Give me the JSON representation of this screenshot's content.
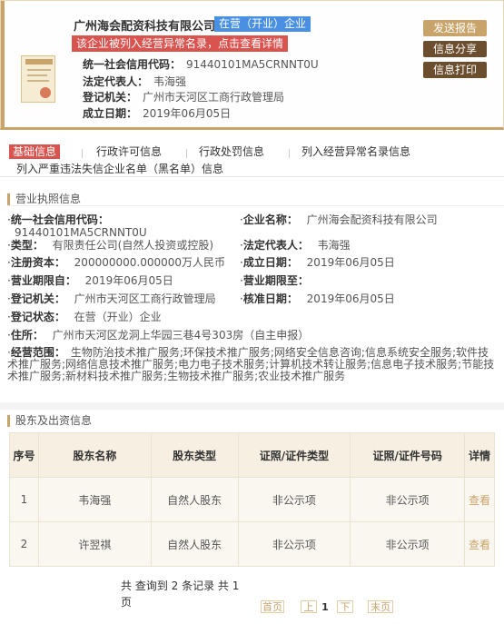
{
  "company": {
    "name": "广州海会配资科技有限公司",
    "status": "在营（开业）企业",
    "abnormal_notice": "该企业被列入经营异常名录，点击查看详情",
    "credit_code_label": "统一社会信用代码：",
    "credit_code": "91440101MA5CRNNT0U",
    "legal_rep_label": "法定代表人：",
    "legal_rep": "韦海强",
    "registry_label": "登记机关：",
    "registry": "广州市天河区工商行政管理局",
    "founded_label": "成立日期：",
    "founded": "2019年06月05日"
  },
  "actions": {
    "report": "发送报告",
    "share": "信息分享",
    "print": "信息打印"
  },
  "tabs": [
    "基础信息",
    "行政许可信息",
    "行政处罚信息",
    "列入经营异常名录信息",
    "列入严重违法失信企业名单（黑名单）信息"
  ],
  "license": {
    "section_title": "营业执照信息",
    "credit_code_label": "统一社会信用代码：",
    "credit_code": "91440101MA5CRNNT0U",
    "name_label": "企业名称：",
    "name": "广州海会配资科技有限公司",
    "type_label": "类型：",
    "type": "有限责任公司(自然人投资或控股)",
    "legal_rep_label": "法定代表人：",
    "legal_rep": "韦海强",
    "capital_label": "注册资本：",
    "capital": "200000000.000000万人民币",
    "founded_label": "成立日期：",
    "founded": "2019年06月05日",
    "term_start_label": "营业期限自：",
    "term_start": "2019年06月05日",
    "term_end_label": "营业期限至：",
    "term_end": "",
    "registry_label": "登记机关：",
    "registry": "广州市天河区工商行政管理局",
    "approval_label": "核准日期：",
    "approval": "2019年06月05日",
    "reg_status_label": "登记状态：",
    "reg_status": "在营（开业）企业",
    "address_label": "住所：",
    "address": "广州市天河区龙洞上华园三巷4号303房（自主申报）",
    "scope_label": "经营范围：",
    "scope": "生物防治技术推广服务;环保技术推广服务;网络安全信息咨询;信息系统安全服务;软件技术推广服务;网络信息技术推广服务;电力电子技术服务;计算机技术转让服务;信息电子技术服务;节能技术推广服务;新材料技术推广服务;生物技术推广服务;农业技术推广服务"
  },
  "shareholders": {
    "section_title": "股东及出资信息",
    "headers": [
      "序号",
      "股东名称",
      "股东类型",
      "证照/证件类型",
      "证照/证件号码",
      "详情"
    ],
    "rows": [
      {
        "no": "1",
        "name": "韦海强",
        "type": "自然人股东",
        "id_type": "非公示项",
        "id_no": "非公示项",
        "detail": "查看"
      },
      {
        "no": "2",
        "name": "许翌祺",
        "type": "自然人股东",
        "id_type": "非公示项",
        "id_no": "非公示项",
        "detail": "查看"
      }
    ],
    "summary": "共 查询到 2 条记录 共 1 页",
    "pager": {
      "first": "首页",
      "prev": "上",
      "current": "1",
      "next": "下",
      "last": "末页"
    }
  },
  "colors": {
    "gold": "#c9a46a",
    "brown": "#6b4e2e",
    "red": "#d9534f",
    "blue": "#4a90e2"
  }
}
